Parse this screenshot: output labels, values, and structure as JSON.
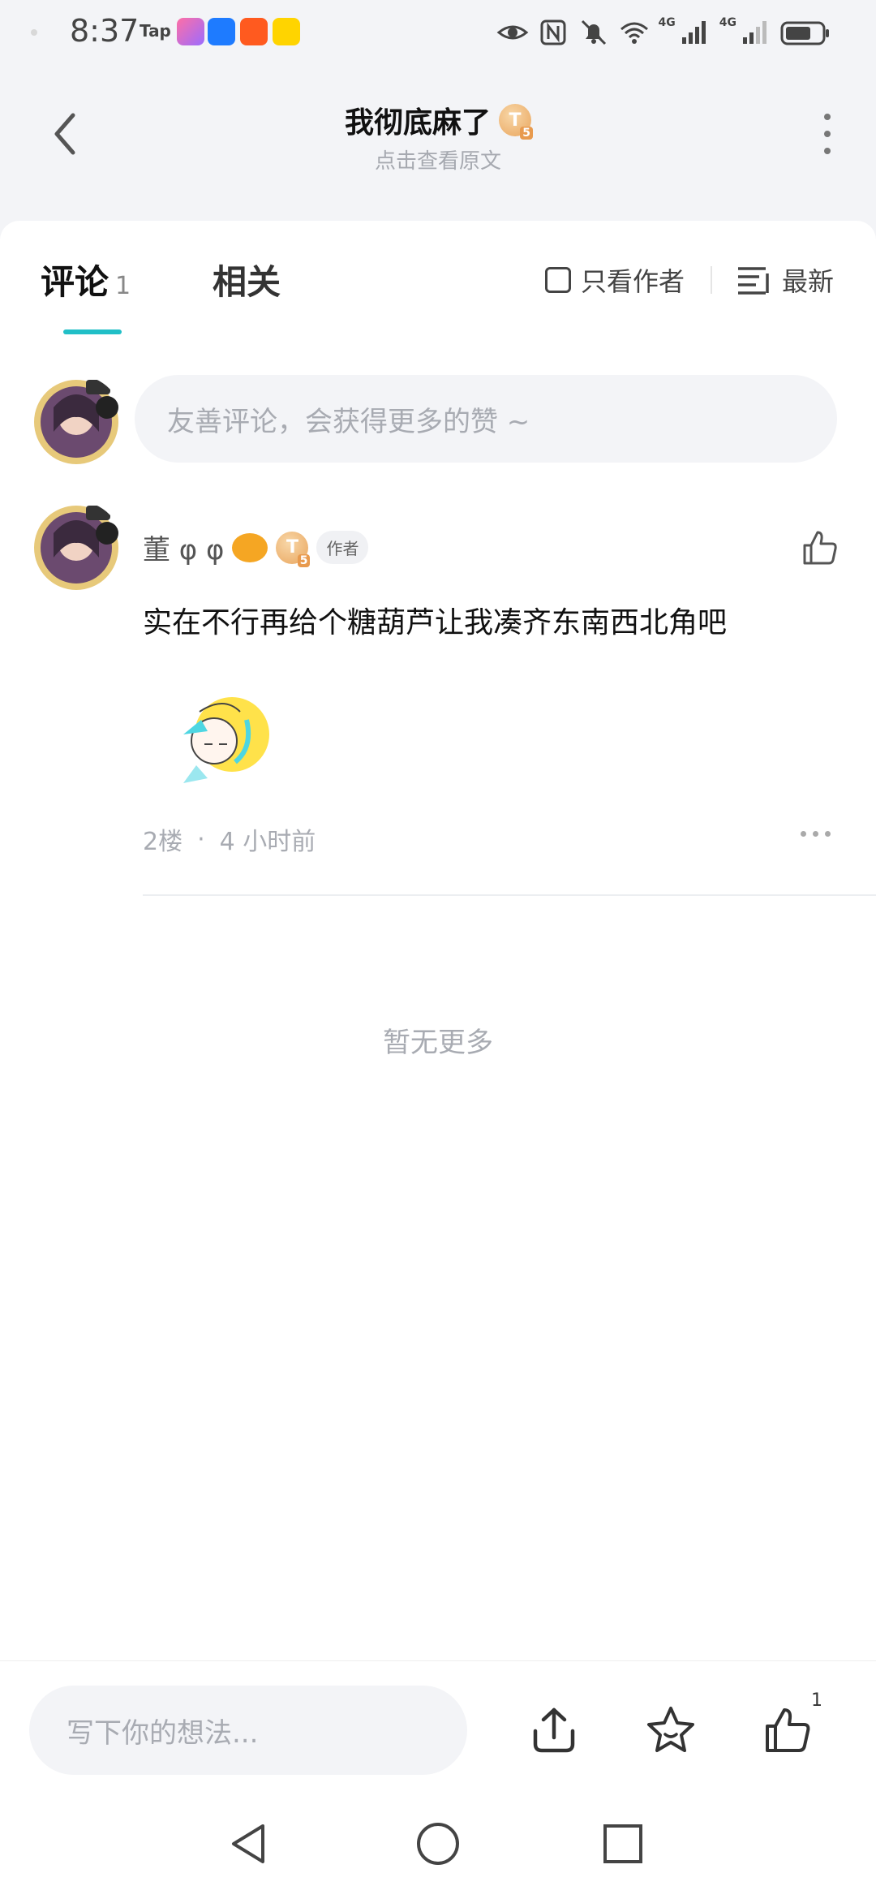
{
  "status_bar": {
    "time": "8:37",
    "tap_label": "Tap",
    "network_1": "4G",
    "network_2": "4G",
    "icons": [
      "eye-icon",
      "nfc-icon",
      "mute-bell-icon",
      "wifi-icon",
      "signal-icon",
      "battery-icon"
    ]
  },
  "header": {
    "title": "我彻底麻了",
    "badge_letter": "T",
    "badge_level": "5",
    "subtitle": "点击查看原文"
  },
  "tabs": {
    "comments_label": "评论",
    "comments_count": "1",
    "related_label": "相关",
    "only_author_label": "只看作者",
    "sort_label": "最新"
  },
  "compose": {
    "placeholder": "友善评论，会获得更多的赞 ~"
  },
  "comment": {
    "author": "董 φ φ",
    "badge_letter": "T",
    "badge_level": "5",
    "author_tag": "作者",
    "text": "实在不行再给个糖葫芦让我凑齐东南西北角吧",
    "floor": "2楼",
    "separator": "·",
    "time": "4 小时前"
  },
  "footer_note": "暂无更多",
  "bottom_bar": {
    "placeholder": "写下你的想法...",
    "like_count": "1"
  },
  "colors": {
    "accent": "#21bfc7",
    "background": "#f3f4f7",
    "badge": "#e9a55d"
  }
}
